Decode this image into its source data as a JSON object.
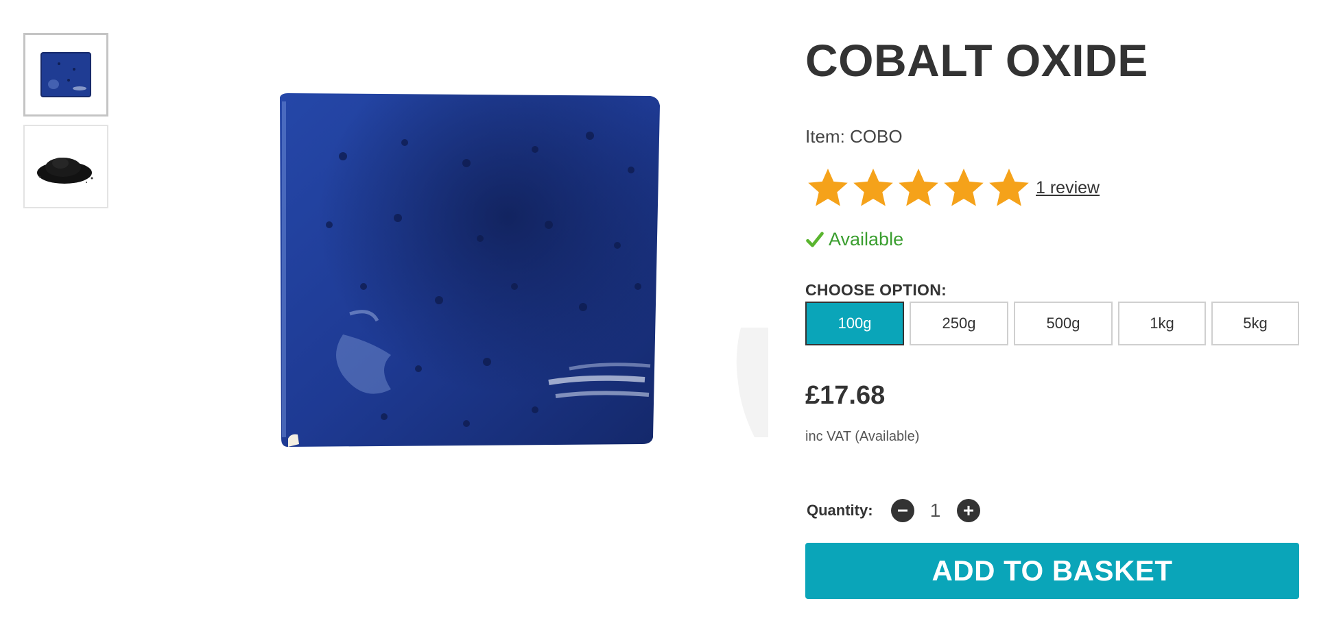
{
  "product": {
    "title": "COBALT OXIDE",
    "item_code": "Item: COBO",
    "rating_stars": 5,
    "review_link": "1 review",
    "availability": "Available",
    "choose_label": "CHOOSE OPTION:",
    "options": [
      {
        "label": "100g",
        "selected": true
      },
      {
        "label": "250g",
        "selected": false
      },
      {
        "label": "500g",
        "selected": false
      },
      {
        "label": "1kg",
        "selected": false
      },
      {
        "label": "5kg",
        "selected": false
      }
    ],
    "price": "£17.68",
    "vat_note": "inc VAT (Available)",
    "quantity_label": "Quantity:",
    "quantity_value": "1",
    "add_button": "ADD TO BASKET"
  },
  "gallery": {
    "thumbnails": [
      {
        "name": "cobalt-glaze-tile",
        "active": true
      },
      {
        "name": "cobalt-oxide-powder",
        "active": false
      }
    ]
  },
  "colors": {
    "accent": "#0aa5b9",
    "star": "#f5a21a",
    "available": "#3a9e2f",
    "text": "#333333",
    "tile_blue": "#1e3a8f"
  }
}
